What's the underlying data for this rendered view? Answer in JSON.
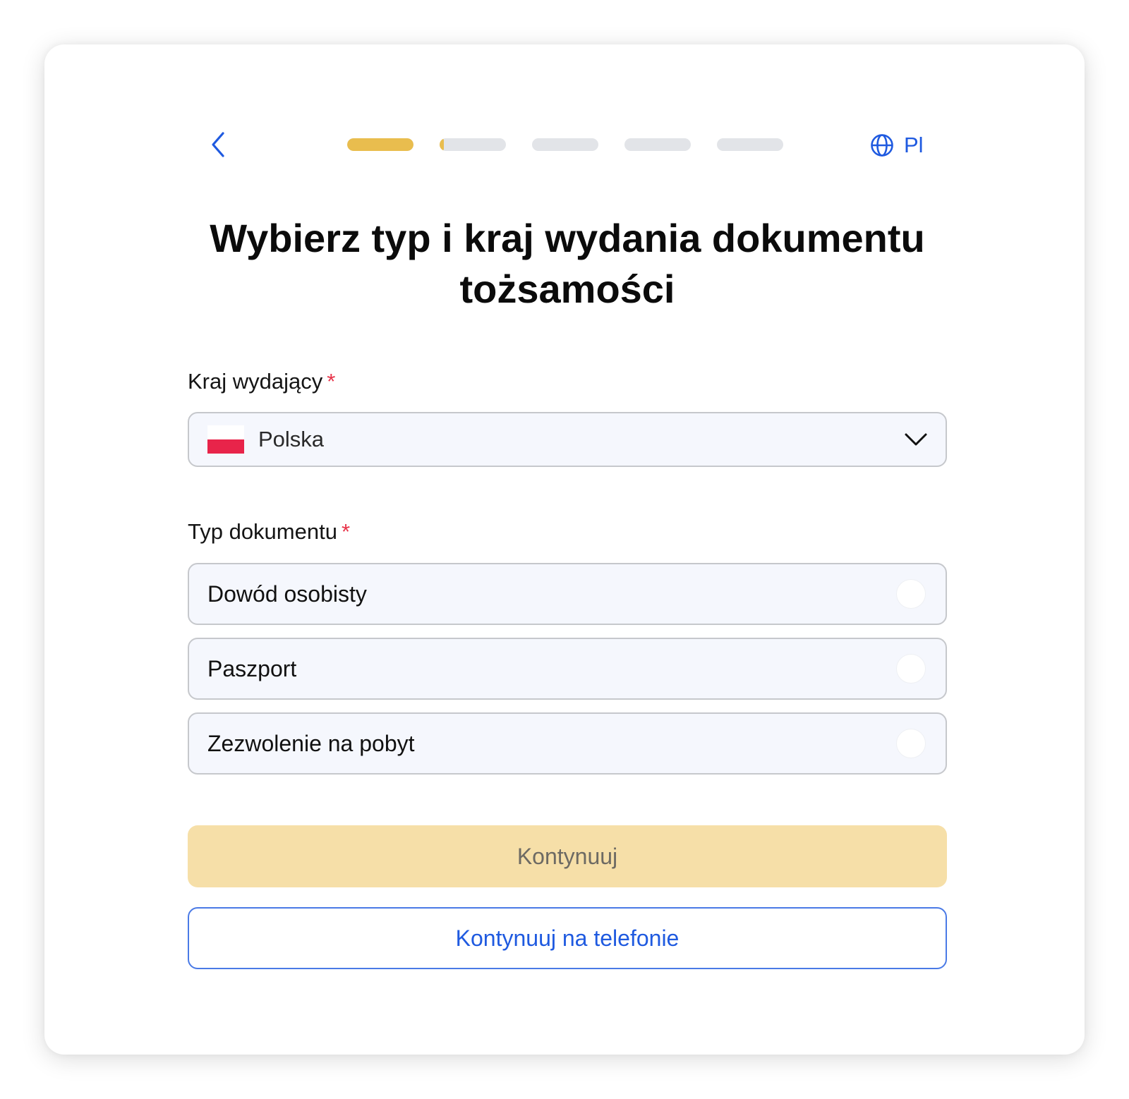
{
  "colors": {
    "accent_blue": "#1f5ae0",
    "progress_active": "#e9bd4e",
    "progress_inactive": "#e2e4e8",
    "required_star": "#e8344a",
    "primary_button_bg": "#f6dfa8",
    "secondary_button_border": "#4a7ae6"
  },
  "header": {
    "back_icon": "chevron-left-icon",
    "progress": {
      "total_steps": 5,
      "steps": [
        {
          "fill": 1.0
        },
        {
          "fill": 0.06
        },
        {
          "fill": 0
        },
        {
          "fill": 0
        },
        {
          "fill": 0
        }
      ]
    },
    "language": {
      "icon": "globe-icon",
      "label": "Pl"
    }
  },
  "title": "Wybierz typ i kraj wydania dokumentu tożsamości",
  "country": {
    "label": "Kraj wydający",
    "required_mark": "*",
    "selected": "Polska",
    "flag_icon": "poland-flag-icon",
    "chevron_icon": "chevron-down-icon"
  },
  "document_type": {
    "label": "Typ dokumentu",
    "required_mark": "*",
    "options": [
      {
        "label": "Dowód osobisty",
        "selected": false
      },
      {
        "label": "Paszport",
        "selected": false
      },
      {
        "label": "Zezwolenie na pobyt",
        "selected": false
      }
    ]
  },
  "actions": {
    "continue": "Kontynuuj",
    "continue_on_phone": "Kontynuuj na telefonie"
  }
}
